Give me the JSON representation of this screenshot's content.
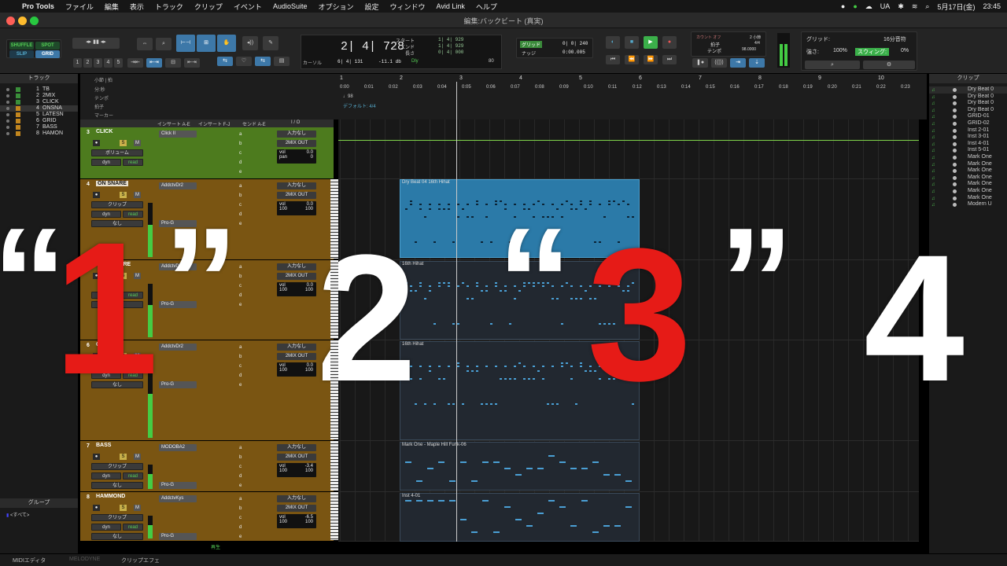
{
  "menubar": {
    "app": "Pro Tools",
    "items": [
      "ファイル",
      "編集",
      "表示",
      "トラック",
      "クリップ",
      "イベント",
      "AudioSuite",
      "オプション",
      "設定",
      "ウィンドウ",
      "Avid Link",
      "ヘルプ"
    ],
    "status_text": "UA",
    "date": "5月17日(金)",
    "time": "23:45"
  },
  "window_title": "編集:バックビート (真実)",
  "toolbar": {
    "modes": [
      "SHUFFLE",
      "SPOT",
      "SLIP",
      "GRID"
    ],
    "numbers": [
      "1",
      "2",
      "3",
      "4",
      "5"
    ],
    "counter_main": "2| 4| 728",
    "counter_sub_label": "カーソル",
    "counter_sub_value": "6| 4| 131",
    "counter_db": "-11.1 db",
    "start_label": "スタート",
    "end_label": "エンド",
    "length_label": "長さ",
    "start_val": "1| 4| 929",
    "end_val": "1| 4| 929",
    "length_val": "0| 4| 000",
    "dly_label": "Dly",
    "tempo_num": "80",
    "grid_label": "グリッド",
    "nudge_label": "ナッジ",
    "grid_val": "0| 0| 240",
    "nudge_val": "0:00.005",
    "countoff": "カウント オフ",
    "meter_label": "拍子",
    "tempo_label": "テンポ",
    "bars_label": "2 小節",
    "meter_val": "4/4",
    "tempo_val": "98.0000",
    "grid_right_label": "グリッド:",
    "grid_right_val": "16分音符",
    "strength_label": "強さ:",
    "strength_val": "100%",
    "swing_label": "スウィング:",
    "swing_val": "0%"
  },
  "left_pane": {
    "tracks_header": "トラック",
    "tracks": [
      {
        "num": "1",
        "name": "TB"
      },
      {
        "num": "2",
        "name": "2MIX"
      },
      {
        "num": "3",
        "name": "CLICK"
      },
      {
        "num": "4",
        "name": "ONSNA"
      },
      {
        "num": "5",
        "name": "LATESN"
      },
      {
        "num": "6",
        "name": "GRID"
      },
      {
        "num": "7",
        "name": "BASS"
      },
      {
        "num": "8",
        "name": "HAMON"
      }
    ],
    "groups_header": "グループ",
    "groups_all": "<すべて>"
  },
  "rulers": {
    "labels": [
      "小節 | 拍",
      "分:秒",
      "テンポ",
      "拍子",
      "マーカー"
    ],
    "bars": [
      "1",
      "2",
      "3",
      "4",
      "5",
      "6",
      "7",
      "8",
      "9",
      "10"
    ],
    "times": [
      "0:00",
      "0:01",
      "0:02",
      "0:03",
      "0:04",
      "0:05",
      "0:06",
      "0:07",
      "0:08",
      "0:09",
      "0:10",
      "0:11",
      "0:12",
      "0:13",
      "0:14",
      "0:15",
      "0:16",
      "0:17",
      "0:18",
      "0:19",
      "0:20",
      "0:21",
      "0:22",
      "0:23"
    ],
    "tempo_marker": "98",
    "meter_marker": "デフォルト: 4/4"
  },
  "mix_header": {
    "inserts_ae": "インサート A-E",
    "inserts_fj": "インサート F-J",
    "sends": "センド A-E",
    "io": "I / O"
  },
  "strips": [
    {
      "num": "3",
      "name": "CLICK",
      "view": "ボリューム",
      "insert": "Click II",
      "io_in": "入力なし",
      "io_out": "2MIX OUT",
      "vol": "0.0",
      "pan": "0"
    },
    {
      "num": "4",
      "name": "ON SNARE",
      "view": "クリップ",
      "insert": "AddctvDr2",
      "insert2": "Pro-G",
      "io_in": "入力なし",
      "io_out": "2MIX OUT",
      "vol": "0.0",
      "pan1": "100",
      "pan2": "100"
    },
    {
      "num": "5",
      "name": "LATE SNARE",
      "insert": "AddctvDr2",
      "insert2": "Pro-G",
      "io_in": "入力なし",
      "io_out": "2MIX OUT",
      "vol": "0.0",
      "pan1": "100",
      "pan2": "100"
    },
    {
      "num": "6",
      "name": "GRID",
      "insert": "AddctvDr2",
      "insert2": "Pro-G",
      "io_in": "入力なし",
      "io_out": "2MIX OUT",
      "vol": "0.0",
      "pan1": "100",
      "pan2": "100"
    },
    {
      "num": "7",
      "name": "BASS",
      "view": "クリップ",
      "insert": "MODOBA2",
      "insert2": "Pro-G",
      "io_in": "入力なし",
      "io_out": "2MIX OUT",
      "vol": "-3.4",
      "pan1": "100",
      "pan2": "100"
    },
    {
      "num": "8",
      "name": "HAMMOND",
      "view": "クリップ",
      "insert": "AddctvKys",
      "insert2": "Pro-G",
      "io_in": "入力なし",
      "io_out": "2MIX OUT",
      "vol": "-6.5",
      "pan1": "100",
      "pan2": "100"
    }
  ],
  "strip_common": {
    "dyn": "dyn",
    "read": "read",
    "none": "なし",
    "vol": "vol",
    "pan": "pan",
    "sends": [
      "a",
      "b",
      "c",
      "d",
      "e"
    ],
    "play": "再生"
  },
  "clips": [
    {
      "name": "Dry Beat 04 16th Hihat"
    },
    {
      "name": "16th Hihat"
    },
    {
      "name": "16th Hihat"
    },
    {
      "name": "Mark One - Maple Hill Funk-06"
    },
    {
      "name": "Inst 4-01"
    }
  ],
  "right_pane": {
    "header": "クリップ",
    "items": [
      "Dry Beat 0",
      "Dry Beat 0",
      "Dry Beat 0",
      "Dry Beat 0",
      "GRID-01",
      "GRID-02",
      "Inst 2-01",
      "Inst 3-01",
      "Inst 4-01",
      "Inst 5-01",
      "Mark One",
      "Mark One",
      "Mark One",
      "Mark One",
      "Mark One",
      "Mark One",
      "Mark One",
      "Modern U"
    ]
  },
  "bottom_tabs": [
    "MIDIエディタ",
    "MELODYNE",
    "クリップエフェ"
  ],
  "overlay": {
    "q1_open": "“",
    "n1": "1",
    "q1_close": "”",
    "n2": "2",
    "q3_open": "“",
    "n3": "3",
    "q3_close": "”",
    "n4": "4"
  },
  "colors": {
    "accent_blue": "#3d78a8",
    "clip_selected": "#2b7aa8",
    "overlay_red": "#e61b17",
    "strip_brown": "#7a5512",
    "strip_green": "#4d7b1e",
    "record_green": "#44cc44"
  }
}
